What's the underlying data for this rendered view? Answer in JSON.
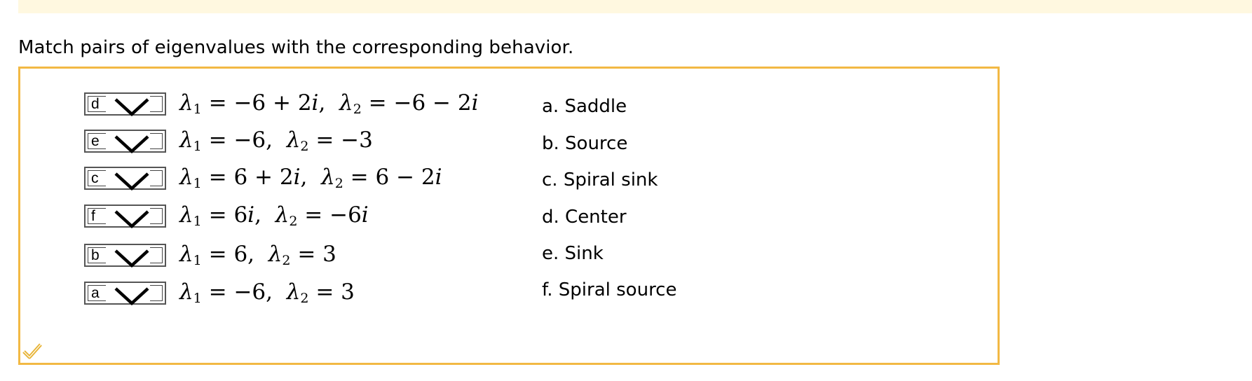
{
  "prompt": "Match pairs of eigenvalues with the corresponding behavior.",
  "accent_color": "#f2b944",
  "banner_color": "#fff8e0",
  "check_icon_color": "#e8b436",
  "rows": [
    {
      "selected": "d",
      "l1": "−6 + 2",
      "l1_i": "i",
      "l2": "−6 − 2",
      "l2_i": "i"
    },
    {
      "selected": "e",
      "l1": "−6,",
      "l1_i": "",
      "l2": "−3",
      "l2_i": ""
    },
    {
      "selected": "c",
      "l1": "6 + 2",
      "l1_i": "i",
      "l2": "6 − 2",
      "l2_i": "i"
    },
    {
      "selected": "f",
      "l1": "6",
      "l1_i": "i",
      "l2": "−6",
      "l2_i": "i"
    },
    {
      "selected": "b",
      "l1": "6,",
      "l1_i": "",
      "l2": "3",
      "l2_i": ""
    },
    {
      "selected": "a",
      "l1": "−6,",
      "l1_i": "",
      "l2": "3",
      "l2_i": ""
    }
  ],
  "answers": [
    "a. Saddle",
    "b. Source",
    "c. Spiral sink",
    "d. Center",
    "e. Sink",
    "f. Spiral source"
  ],
  "lambda": "λ",
  "sub1": "1",
  "sub2": "2",
  "equals": " = "
}
